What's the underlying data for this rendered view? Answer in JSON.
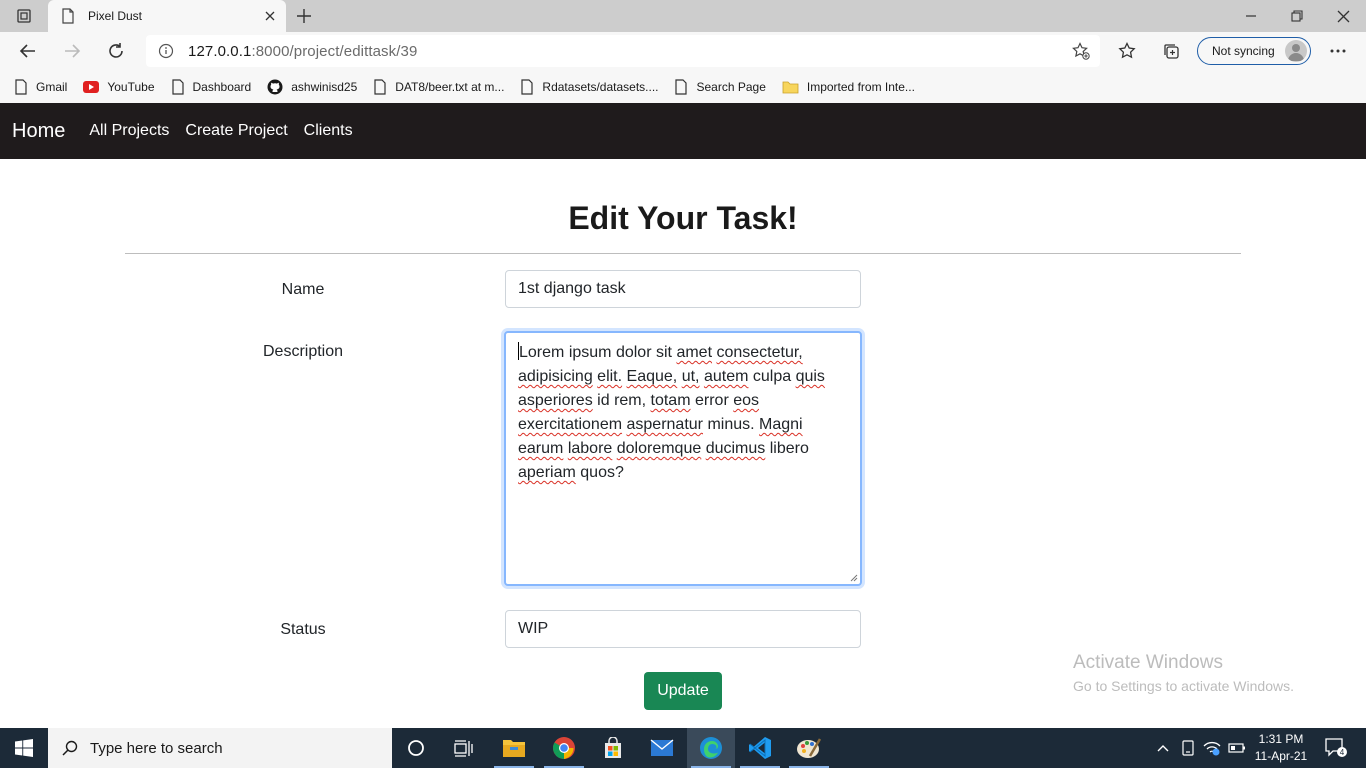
{
  "browser": {
    "tab_title": "Pixel Dust",
    "url_host": "127.0.0.1",
    "url_rest": ":8000/project/edittask/39",
    "sync_label": "Not syncing",
    "bookmarks": [
      "Gmail",
      "YouTube",
      "Dashboard",
      "ashwinisd25",
      "DAT8/beer.txt at m...",
      "Rdatasets/datasets....",
      "Search Page",
      "Imported from Inte..."
    ]
  },
  "nav": {
    "brand": "Home",
    "links": [
      "All Projects",
      "Create Project",
      "Clients"
    ]
  },
  "form": {
    "heading": "Edit Your Task!",
    "name_label": "Name",
    "name_value": "1st django task",
    "description_label": "Description",
    "description_words": [
      "Lorem",
      "ipsum",
      "dolor",
      "sit",
      "amet",
      "consectetur,",
      "adipisicing",
      "elit.",
      "Eaque,",
      "ut,",
      "autem",
      "culpa",
      "quis",
      "asperiores",
      "id",
      "rem,",
      "totam",
      "error",
      "eos",
      "exercitationem",
      "aspernatur",
      "minus.",
      "Magni",
      "earum",
      "labore",
      "doloremque",
      "ducimus",
      "libero",
      "aperiam",
      "quos?"
    ],
    "status_label": "Status",
    "status_value": "WIP",
    "update_label": "Update"
  },
  "watermark": {
    "line1": "Activate Windows",
    "line2": "Go to Settings to activate Windows."
  },
  "taskbar": {
    "search_placeholder": "Type here to search",
    "time": "1:31 PM",
    "date": "11-Apr-21",
    "notification_count": "4"
  },
  "colors": {
    "navbar_bg": "#1f1b1c",
    "update_button": "#198754",
    "focus_border": "#86b7fe",
    "taskbar_bg": "#1c2a38"
  }
}
